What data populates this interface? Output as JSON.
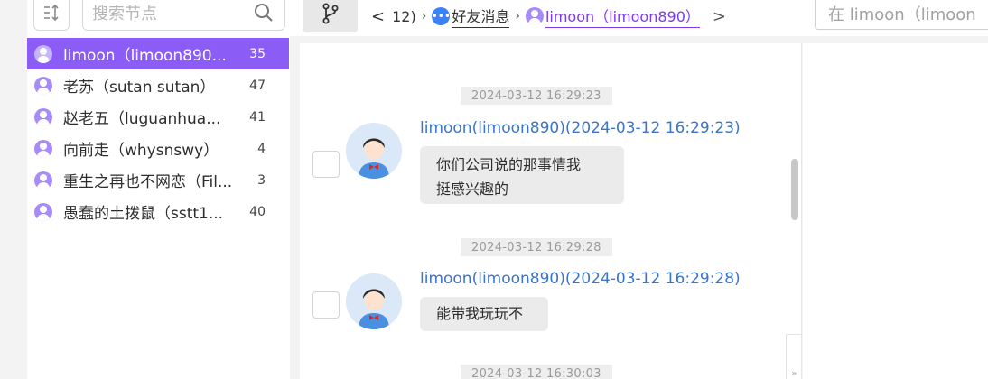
{
  "sidebar": {
    "search": {
      "placeholder": "搜索节点"
    },
    "items": [
      {
        "name": "limoon（limoon890...",
        "count": "35",
        "active": true
      },
      {
        "name": "老苏（sutan sutan）",
        "count": "47"
      },
      {
        "name": "赵老五（luguanhua...",
        "count": "41"
      },
      {
        "name": "向前走（whysnswy）",
        "count": "4"
      },
      {
        "name": "重生之再也不网恋（Fil...",
        "count": "3"
      },
      {
        "name": "愚蠢的土拨鼠（sstt1...",
        "count": "40"
      }
    ]
  },
  "header": {
    "breadcrumb": {
      "prev": "<",
      "count": "12)",
      "sep": "›",
      "messages_label": "好友消息",
      "current_label": "limoon（limoon890）",
      "next": ">"
    },
    "right_search": {
      "placeholder": "在 limoon（limoon"
    }
  },
  "chat": {
    "messages": [
      {
        "timestamp": "2024-03-12 16:29:23",
        "sender": "limoon(limoon890)(2024-03-12 16:29:23)",
        "lines": [
          "你们公司说的那事情我",
          "挺感兴趣的"
        ]
      },
      {
        "timestamp": "2024-03-12 16:29:28",
        "sender": "limoon(limoon890)(2024-03-12 16:29:28)",
        "lines": [
          "能带我玩玩不"
        ]
      },
      {
        "timestamp": "2024-03-12 16:30:03"
      }
    ]
  },
  "colors": {
    "accent": "#8b5cf6",
    "sender_link": "#3b74c9",
    "bubble_bg": "#ebebeb"
  }
}
